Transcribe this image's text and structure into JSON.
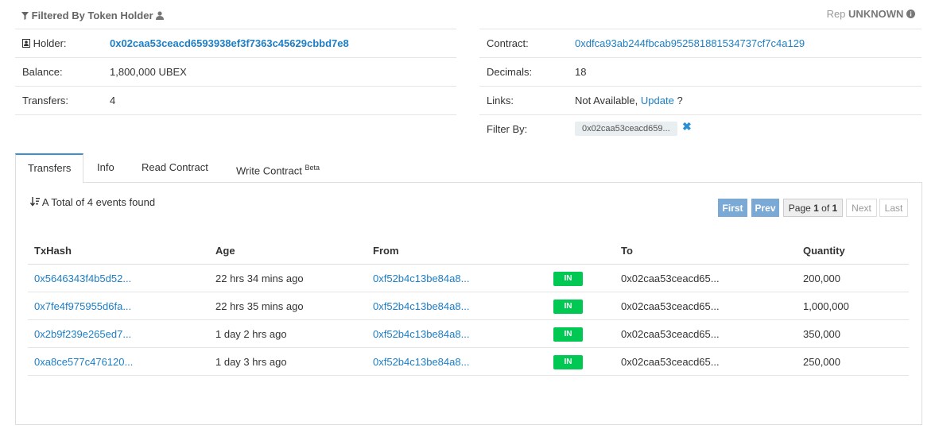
{
  "header": {
    "title": "Filtered By Token Holder",
    "rep_label": "Rep",
    "rep_value": "UNKNOWN"
  },
  "holder": {
    "label": "Holder:",
    "address": "0x02caa53ceacd6593938ef3f7363c45629cbbd7e8",
    "balance_label": "Balance:",
    "balance": "1,800,000 UBEX",
    "transfers_label": "Transfers:",
    "transfers": "4"
  },
  "contract": {
    "label": "Contract:",
    "address": "0xdfca93ab244fbcab952581881534737cf7c4a129",
    "decimals_label": "Decimals:",
    "decimals": "18",
    "links_label": "Links:",
    "links_text": "Not Available,",
    "update_link": "Update",
    "question": "?",
    "filter_label": "Filter By:",
    "filter_value": "0x02caa53ceacd659..."
  },
  "tabs": [
    {
      "label": "Transfers",
      "active": true
    },
    {
      "label": "Info"
    },
    {
      "label": "Read Contract"
    },
    {
      "label": "Write Contract",
      "badge": "Beta"
    }
  ],
  "transfers": {
    "total_text": "A Total of 4 events found",
    "pagination": {
      "first": "First",
      "prev": "Prev",
      "page_prefix": "Page",
      "page_current": "1",
      "page_of": "of",
      "page_total": "1",
      "next": "Next",
      "last": "Last"
    },
    "columns": [
      "TxHash",
      "Age",
      "From",
      "",
      "To",
      "Quantity"
    ],
    "rows": [
      {
        "txhash": "0x5646343f4b5d52...",
        "age": "22 hrs 34 mins ago",
        "from": "0xf52b4c13be84a8...",
        "dir": "IN",
        "to": "0x02caa53ceacd65...",
        "qty": "200,000"
      },
      {
        "txhash": "0x7fe4f975955d6fa...",
        "age": "22 hrs 35 mins ago",
        "from": "0xf52b4c13be84a8...",
        "dir": "IN",
        "to": "0x02caa53ceacd65...",
        "qty": "1,000,000"
      },
      {
        "txhash": "0x2b9f239e265ed7...",
        "age": "1 day 2 hrs ago",
        "from": "0xf52b4c13be84a8...",
        "dir": "IN",
        "to": "0x02caa53ceacd65...",
        "qty": "350,000"
      },
      {
        "txhash": "0xa8ce577c476120...",
        "age": "1 day 3 hrs ago",
        "from": "0xf52b4c13be84a8...",
        "dir": "IN",
        "to": "0x02caa53ceacd65...",
        "qty": "250,000"
      }
    ]
  },
  "colors": {
    "link": "#1c7ec6",
    "in_badge": "#00c853",
    "pager_active": "#7ba9d6",
    "tab_active_border": "#3d8fd1"
  },
  "icons": [
    "filter-icon",
    "user-icon",
    "info-icon",
    "user-square-icon",
    "close-icon",
    "sort-icon"
  ]
}
